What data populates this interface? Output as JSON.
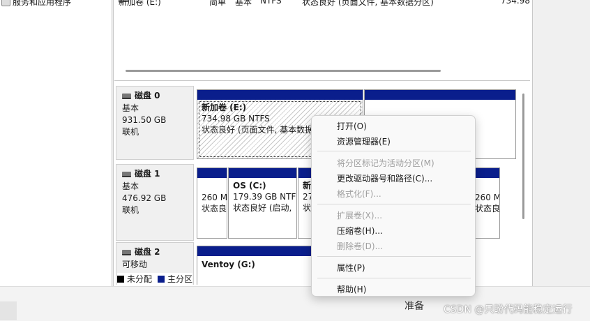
{
  "tree": {
    "item_label": "服务和应用程序"
  },
  "volume_row": {
    "name": "新加卷 (E:)",
    "layout": "简单",
    "type": "基本",
    "fs": "NTFS",
    "status": "状态良好 (页面文件, 基本数据分区)",
    "capacity": "734.98"
  },
  "disks": [
    {
      "name": "磁盘 0",
      "type": "基本",
      "size": "931.50 GB",
      "state": "联机",
      "partitions": [
        {
          "name": "新加卷 (E:)",
          "size": "734.98 GB NTFS",
          "status": "状态良好 (页面文件, 基本数据分区)"
        },
        {
          "name": "",
          "size": "",
          "status": ""
        }
      ]
    },
    {
      "name": "磁盘 1",
      "type": "基本",
      "size": "476.92 GB",
      "state": "联机",
      "partitions": [
        {
          "name": "",
          "size": "260 M",
          "status": "状态良"
        },
        {
          "name": "OS (C:)",
          "size": "179.39 GB NTF",
          "status": "状态良好 (启动,"
        },
        {
          "name": "新",
          "size": "27",
          "status": "状"
        },
        {
          "name": "",
          "size": "260 M",
          "status": "状态良"
        }
      ]
    },
    {
      "name": "磁盘 2",
      "type": "可移动",
      "size": "",
      "state": "",
      "partitions": [
        {
          "name": "Ventoy (G:)",
          "size": "",
          "status": ""
        }
      ]
    }
  ],
  "legend": {
    "unallocated": "未分配",
    "primary": "主分区"
  },
  "colors": {
    "primary_partition": "#0a1e8c",
    "unallocated": "#000000"
  },
  "context_menu": {
    "items": [
      {
        "label": "打开(O)",
        "enabled": true
      },
      {
        "label": "资源管理器(E)",
        "enabled": true
      },
      {
        "label": "将分区标记为活动分区(M)",
        "enabled": false
      },
      {
        "label": "更改驱动器号和路径(C)...",
        "enabled": true
      },
      {
        "label": "格式化(F)...",
        "enabled": false
      },
      {
        "label": "扩展卷(X)...",
        "enabled": false
      },
      {
        "label": "压缩卷(H)...",
        "enabled": true
      },
      {
        "label": "删除卷(D)...",
        "enabled": false
      },
      {
        "label": "属性(P)",
        "enabled": true
      },
      {
        "label": "帮助(H)",
        "enabled": true
      }
    ]
  },
  "status_bar": {
    "text": "准备"
  },
  "watermark": "CSDN @只盼代码能稳定运行"
}
